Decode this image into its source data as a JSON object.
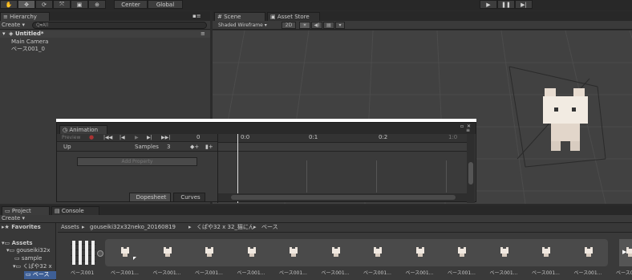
{
  "toolbar": {
    "pivot_label": "Center",
    "space_label": "Global"
  },
  "hierarchy": {
    "tab_label": "Hierarchy",
    "create_label": "Create ▾",
    "search_placeholder": "Q▾All",
    "scene_name": "Untitled*",
    "items": [
      "Main Camera",
      "ベース001_0"
    ]
  },
  "scene": {
    "tab_scene": "Scene",
    "tab_asset_store": "Asset Store",
    "shading_mode": "Shaded Wireframe",
    "mode_2d": "2D"
  },
  "animation": {
    "tab_label": "Animation",
    "preview_label": "Preview",
    "frame_value": "0",
    "clip_name": "Up",
    "samples_label": "Samples",
    "samples_value": "3",
    "add_property_label": "Add Property",
    "dopesheet_label": "Dopesheet",
    "curves_label": "Curves",
    "timeline_ticks": [
      "0:0",
      "0:1",
      "0:2",
      "1:0"
    ]
  },
  "project": {
    "tab_project": "Project",
    "tab_console": "Console",
    "create_label": "Create ▾",
    "favorites_label": "Favorites",
    "breadcrumb": [
      "Assets",
      "gouseiki32x32neko_20160819",
      "くぱや32 x 32_猫にん",
      "ベース"
    ],
    "tree": [
      {
        "label": "Assets",
        "depth": 0
      },
      {
        "label": "gouseiki32x",
        "depth": 1
      },
      {
        "label": "sample",
        "depth": 2
      },
      {
        "label": "くぱや32 x",
        "depth": 2
      },
      {
        "label": "ベース",
        "depth": 3
      }
    ],
    "assets": [
      "ベース001",
      "ベース001...",
      "ベース001...",
      "ベース001...",
      "ベース001...",
      "ベース001...",
      "ベース001...",
      "ベース001...",
      "ベース001...",
      "ベース001...",
      "ベース001...",
      "ベース001...",
      "ベース001...",
      "ベース001..."
    ]
  },
  "colors": {
    "background": "#2b2b2b",
    "panel": "#3a3a3a",
    "selected_tab": "#3c3c3c",
    "timeline_red": "#d04040",
    "scene_grid": "#4a4a4a"
  },
  "icons": [
    "hand-icon",
    "move-icon",
    "rotate-icon",
    "scale-icon",
    "rect-icon",
    "transform-icon",
    "play-icon",
    "pause-icon",
    "step-icon",
    "lock-icon",
    "menu-icon"
  ]
}
